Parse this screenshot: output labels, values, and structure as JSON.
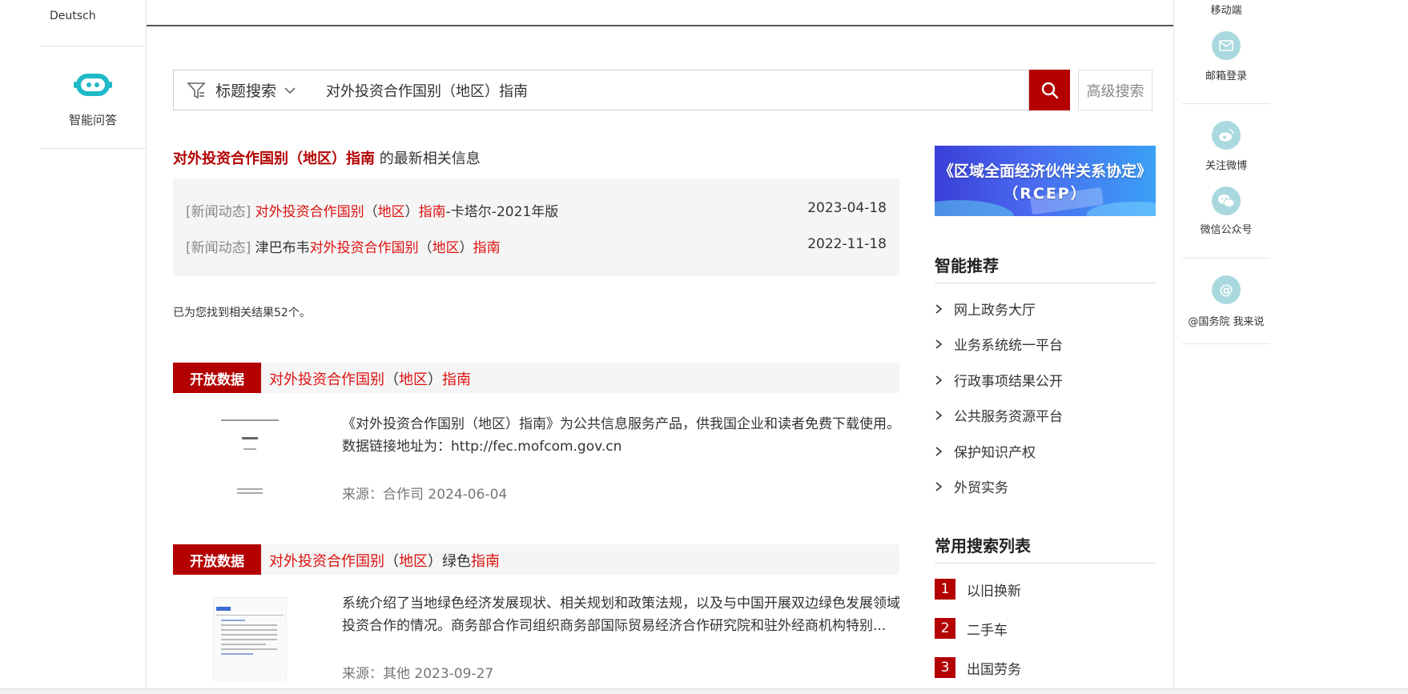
{
  "left_sidebar": {
    "language": "Deutsch",
    "assistant_label": "智能问答",
    "assistant_icon": "robot-icon"
  },
  "search": {
    "type_label": "标题搜索",
    "query": "对外投资合作国别（地区）指南",
    "advanced_label": "高级搜索",
    "accent": "#b30000"
  },
  "latest": {
    "keyword": "对外投资合作国别（地区）指南",
    "suffix": "的最新相关信息",
    "items": [
      {
        "category": "[新闻动态]",
        "parts": [
          {
            "t": "对外投资合作国别",
            "c": "red"
          },
          {
            "t": "（",
            "c": "blk"
          },
          {
            "t": "地区",
            "c": "red"
          },
          {
            "t": "）",
            "c": "blk"
          },
          {
            "t": "指南",
            "c": "red"
          },
          {
            "t": "-卡塔尔-2021年版",
            "c": "blk"
          }
        ],
        "date": "2023-04-18"
      },
      {
        "category": "[新闻动态]",
        "parts": [
          {
            "t": "津巴布韦",
            "c": "blk"
          },
          {
            "t": "对外投资合作国别",
            "c": "red"
          },
          {
            "t": "（",
            "c": "blk"
          },
          {
            "t": "地区",
            "c": "red"
          },
          {
            "t": "）",
            "c": "blk"
          },
          {
            "t": "指南",
            "c": "red"
          }
        ],
        "date": "2022-11-18"
      }
    ]
  },
  "result_count": "已为您找到相关结果52个。",
  "results": [
    {
      "badge": "开放数据",
      "title_parts": [
        {
          "t": "对外投资合作国别",
          "c": "red"
        },
        {
          "t": "（",
          "c": "blk"
        },
        {
          "t": "地区",
          "c": "red"
        },
        {
          "t": "）",
          "c": "blk"
        },
        {
          "t": "指南",
          "c": "red"
        }
      ],
      "desc": "《对外投资合作国别（地区）指南》为公共信息服务产品，供我国企业和读者免费下载使用。数据链接地址为：http://fec.mofcom.gov.cn",
      "source": "来源：合作司 2024-06-04"
    },
    {
      "badge": "开放数据",
      "title_parts": [
        {
          "t": "对外投资合作国别",
          "c": "red"
        },
        {
          "t": "（",
          "c": "blk"
        },
        {
          "t": "地区",
          "c": "red"
        },
        {
          "t": "）",
          "c": "blk"
        },
        {
          "t": "绿色",
          "c": "blk"
        },
        {
          "t": "指南",
          "c": "red"
        }
      ],
      "desc": "系统介绍了当地绿色经济发展现状、相关规划和政策法规，以及与中国开展双边绿色发展领域投资合作的情况。商务部合作司组织商务部国际贸易经济合作研究院和驻外经商机构特别...",
      "source": "来源：其他 2023-09-27"
    }
  ],
  "banner": {
    "line1": "《区域全面经济伙伴关系协定》",
    "line2": "（RCEP）"
  },
  "recommend": {
    "title": "智能推荐",
    "items": [
      "网上政务大厅",
      "业务系统统一平台",
      "行政事项结果公开",
      "公共服务资源平台",
      "保护知识产权",
      "外贸实务"
    ]
  },
  "hot": {
    "title": "常用搜索列表",
    "items": [
      {
        "num": "1",
        "label": "以旧换新"
      },
      {
        "num": "2",
        "label": "二手车"
      },
      {
        "num": "3",
        "label": "出国劳务"
      }
    ]
  },
  "right_sidebar": {
    "mobile_label": "移动端",
    "mail_label": "邮箱登录",
    "weibo_label": "关注微博",
    "wechat_label": "微信公众号",
    "council_label": "@国务院 我来说",
    "icon_color": "#a9d9de"
  }
}
